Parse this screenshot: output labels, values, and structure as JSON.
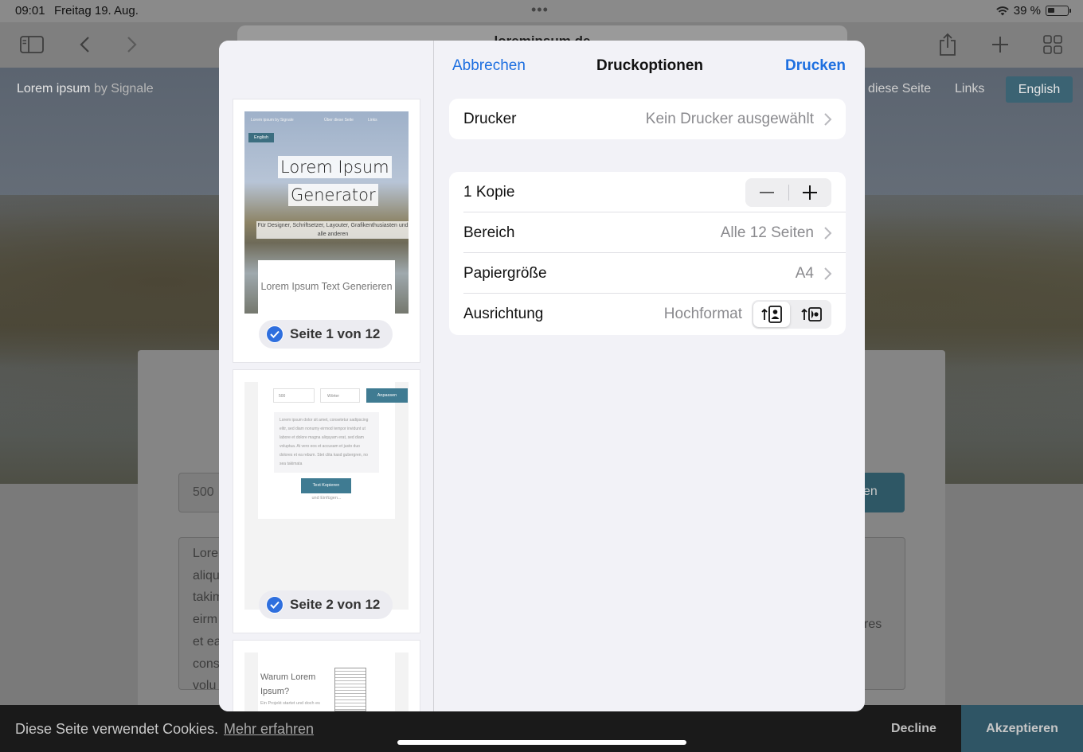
{
  "status_bar": {
    "time": "09:01",
    "date": "Freitag 19. Aug.",
    "battery": "39 %"
  },
  "browser": {
    "url": "loremipsum.de"
  },
  "site": {
    "logo": "Lorem ipsum",
    "logo_sub": "by Signale",
    "nav_this_page": "diese Seite",
    "nav_links": "Links",
    "nav_english": "English",
    "count_value": "500",
    "apply_fragment": "en",
    "text_left_lines": [
      "Lorem",
      "aliqu",
      "takim",
      "eirm",
      "et ea",
      "cons",
      "volu"
    ],
    "text_right_fragment": "res"
  },
  "cookie": {
    "text": "Diese Seite verwendet Cookies.",
    "more": "Mehr erfahren",
    "decline": "Decline",
    "accept": "Akzeptieren"
  },
  "dialog": {
    "cancel": "Abbrechen",
    "title": "Druckoptionen",
    "print": "Drucken",
    "printer_label": "Drucker",
    "printer_value": "Kein Drucker ausgewählt",
    "copies_label": "1 Kopie",
    "range_label": "Bereich",
    "range_value": "Alle 12 Seiten",
    "paper_label": "Papiergröße",
    "paper_value": "A4",
    "orientation_label": "Ausrichtung",
    "orientation_value": "Hochformat",
    "orientation_selected": "portrait"
  },
  "preview": {
    "page1": {
      "badge": "Seite 1 von 12",
      "nav_a": "Lorem ipsum by Signale",
      "nav_b": "Über diese Seite",
      "nav_c": "Links",
      "english": "English",
      "title_1": "Lorem Ipsum",
      "title_2": "Generator",
      "subtitle": "Für Designer, Schriftsetzer, Layouter, Grafikenthusiasten und alle anderen",
      "box_text": "Lorem Ipsum Text Generieren"
    },
    "page2": {
      "badge": "Seite 2 von 12",
      "input": "500",
      "select": "Wörter",
      "apply": "Anpassen",
      "text": "Lorem ipsum dolor sit amet, consetetur sadipscing elitr, sed diam nonumy eirmod tempor invidunt ut labore et dolore magna aliquyam erat, sed diam voluptua. At vero eos et accusam et justo duo dolores et ea rebum. Stet clita kasd gubergren, no sea takimata",
      "copy": "Text Kopieren",
      "paste": "und Einfügen..."
    },
    "page3": {
      "title": "Warum Lorem Ipsum?",
      "small": "Ein Projekt startet und doch es"
    }
  }
}
